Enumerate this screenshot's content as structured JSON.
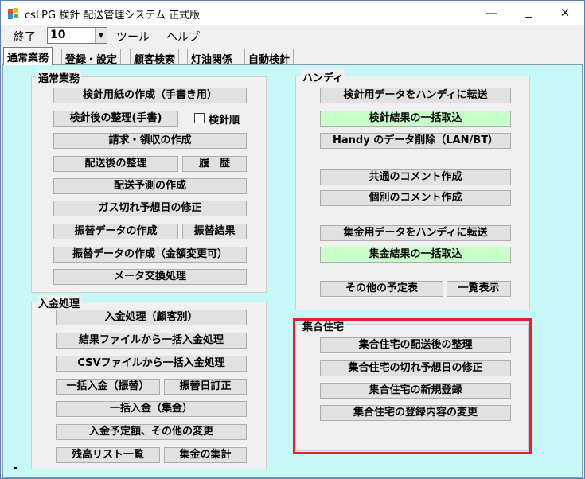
{
  "window": {
    "title": "csLPG 検針 配送管理システム 正式版",
    "min_glyph": "—",
    "close_glyph": "✕"
  },
  "menubar": {
    "exit_label": "終了",
    "combo_value": "10",
    "combo_arrow": "▼",
    "tools_label": "ツール",
    "help_label": "ヘルプ"
  },
  "tabs": [
    {
      "label": "通常業務",
      "active": true
    },
    {
      "label": "登録・設定",
      "active": false
    },
    {
      "label": "顧客検索",
      "active": false
    },
    {
      "label": "灯油関係",
      "active": false
    },
    {
      "label": "自動検針",
      "active": false
    }
  ],
  "normal_group": {
    "title": "通常業務",
    "buttons": {
      "meter_sheet": "検針用紙の作成（手書き用）",
      "post_meter": "検針後の整理(手書)",
      "billing": "請求・領収の作成",
      "post_delivery": "配送後の整理",
      "history": "履　歴",
      "delivery_forecast": "配送予測の作成",
      "gas_out_fix": "ガス切れ予想日の修正",
      "transfer_data": "振替データの作成",
      "transfer_result": "振替結果",
      "transfer_data_amount": "振替データの作成（金額変更可）",
      "meter_exchange": "メータ交換処理"
    },
    "checkbox_label": "検針順"
  },
  "deposit_group": {
    "title": "入金処理",
    "buttons": {
      "by_customer": "入金処理（顧客別）",
      "from_result_file": "結果ファイルから一括入金処理",
      "from_csv": "CSVファイルから一括入金処理",
      "bulk_transfer": "一括入金（振替）",
      "transfer_date_fix": "振替日訂正",
      "bulk_collection": "一括入金（集金）",
      "scheduled_amount": "入金予定額、その他の変更",
      "balance_list": "残高リスト一覧",
      "collection_total": "集金の集計"
    }
  },
  "handy_group": {
    "title": "ハンディ",
    "buttons": {
      "transfer_meter_data": "検針用データをハンディに転送",
      "import_meter_results": "検針結果の一括取込",
      "delete_handy_data": "Handy のデータ削除（LAN/BT）",
      "common_comment": "共通のコメント作成",
      "individual_comment": "個別のコメント作成",
      "transfer_collection_data": "集金用データをハンディに転送",
      "import_collection_results": "集金結果の一括取込",
      "other_schedule": "その他の予定表",
      "list_view": "一覧表示"
    }
  },
  "apartment_group": {
    "title": "集合住宅",
    "buttons": {
      "post_delivery": "集合住宅の配送後の整理",
      "gas_out_fix": "集合住宅の切れ予想日の修正",
      "new_registration": "集合住宅の新規登録",
      "change_registration": "集合住宅の登録内容の変更"
    }
  },
  "colors": {
    "tab_page_bg": "#c6f8f8",
    "highlight_button": "#c8ffc8",
    "annotation_frame": "#e8202a"
  }
}
